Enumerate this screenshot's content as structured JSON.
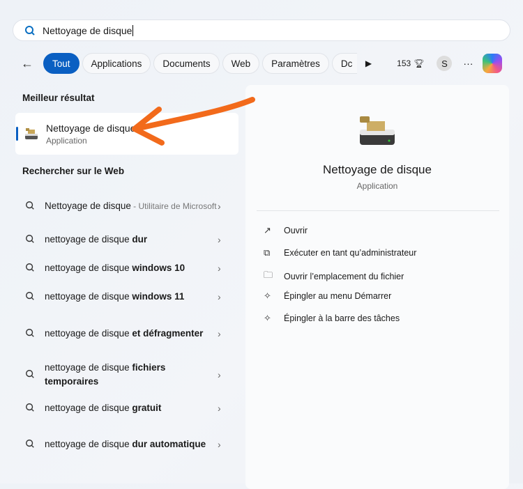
{
  "search": {
    "value": "Nettoyage de disque"
  },
  "filters": {
    "tabs": [
      "Tout",
      "Applications",
      "Documents",
      "Web",
      "Paramètres",
      "Dc"
    ],
    "points": "153",
    "avatar": "S",
    "more": "···"
  },
  "best": {
    "heading": "Meilleur résultat",
    "title": "Nettoyage de disque",
    "subtitle": "Application"
  },
  "web": {
    "heading": "Rechercher sur le Web",
    "items": [
      {
        "normal": "Nettoyage de disque",
        "bold": "",
        "secondary": " - Utilitaire de Microsoft"
      },
      {
        "normal": "nettoyage de disque ",
        "bold": "dur"
      },
      {
        "normal": "nettoyage de disque ",
        "bold": "windows 10"
      },
      {
        "normal": "nettoyage de disque ",
        "bold": "windows 11"
      },
      {
        "normal": "nettoyage de disque ",
        "bold": "et défragmenter"
      },
      {
        "normal": "nettoyage de disque ",
        "bold": "fichiers temporaires"
      },
      {
        "normal": "nettoyage de disque ",
        "bold": "gratuit"
      },
      {
        "normal": "nettoyage de disque ",
        "bold": "dur automatique"
      }
    ]
  },
  "preview": {
    "title": "Nettoyage de disque",
    "subtitle": "Application",
    "actions": [
      "Ouvrir",
      "Exécuter en tant qu’administrateur",
      "Ouvrir l’emplacement du fichier",
      "Épingler au menu Démarrer",
      "Épingler à la barre des tâches"
    ]
  },
  "colors": {
    "accent": "#0a5fc2",
    "annotation": "#f26a1b"
  }
}
